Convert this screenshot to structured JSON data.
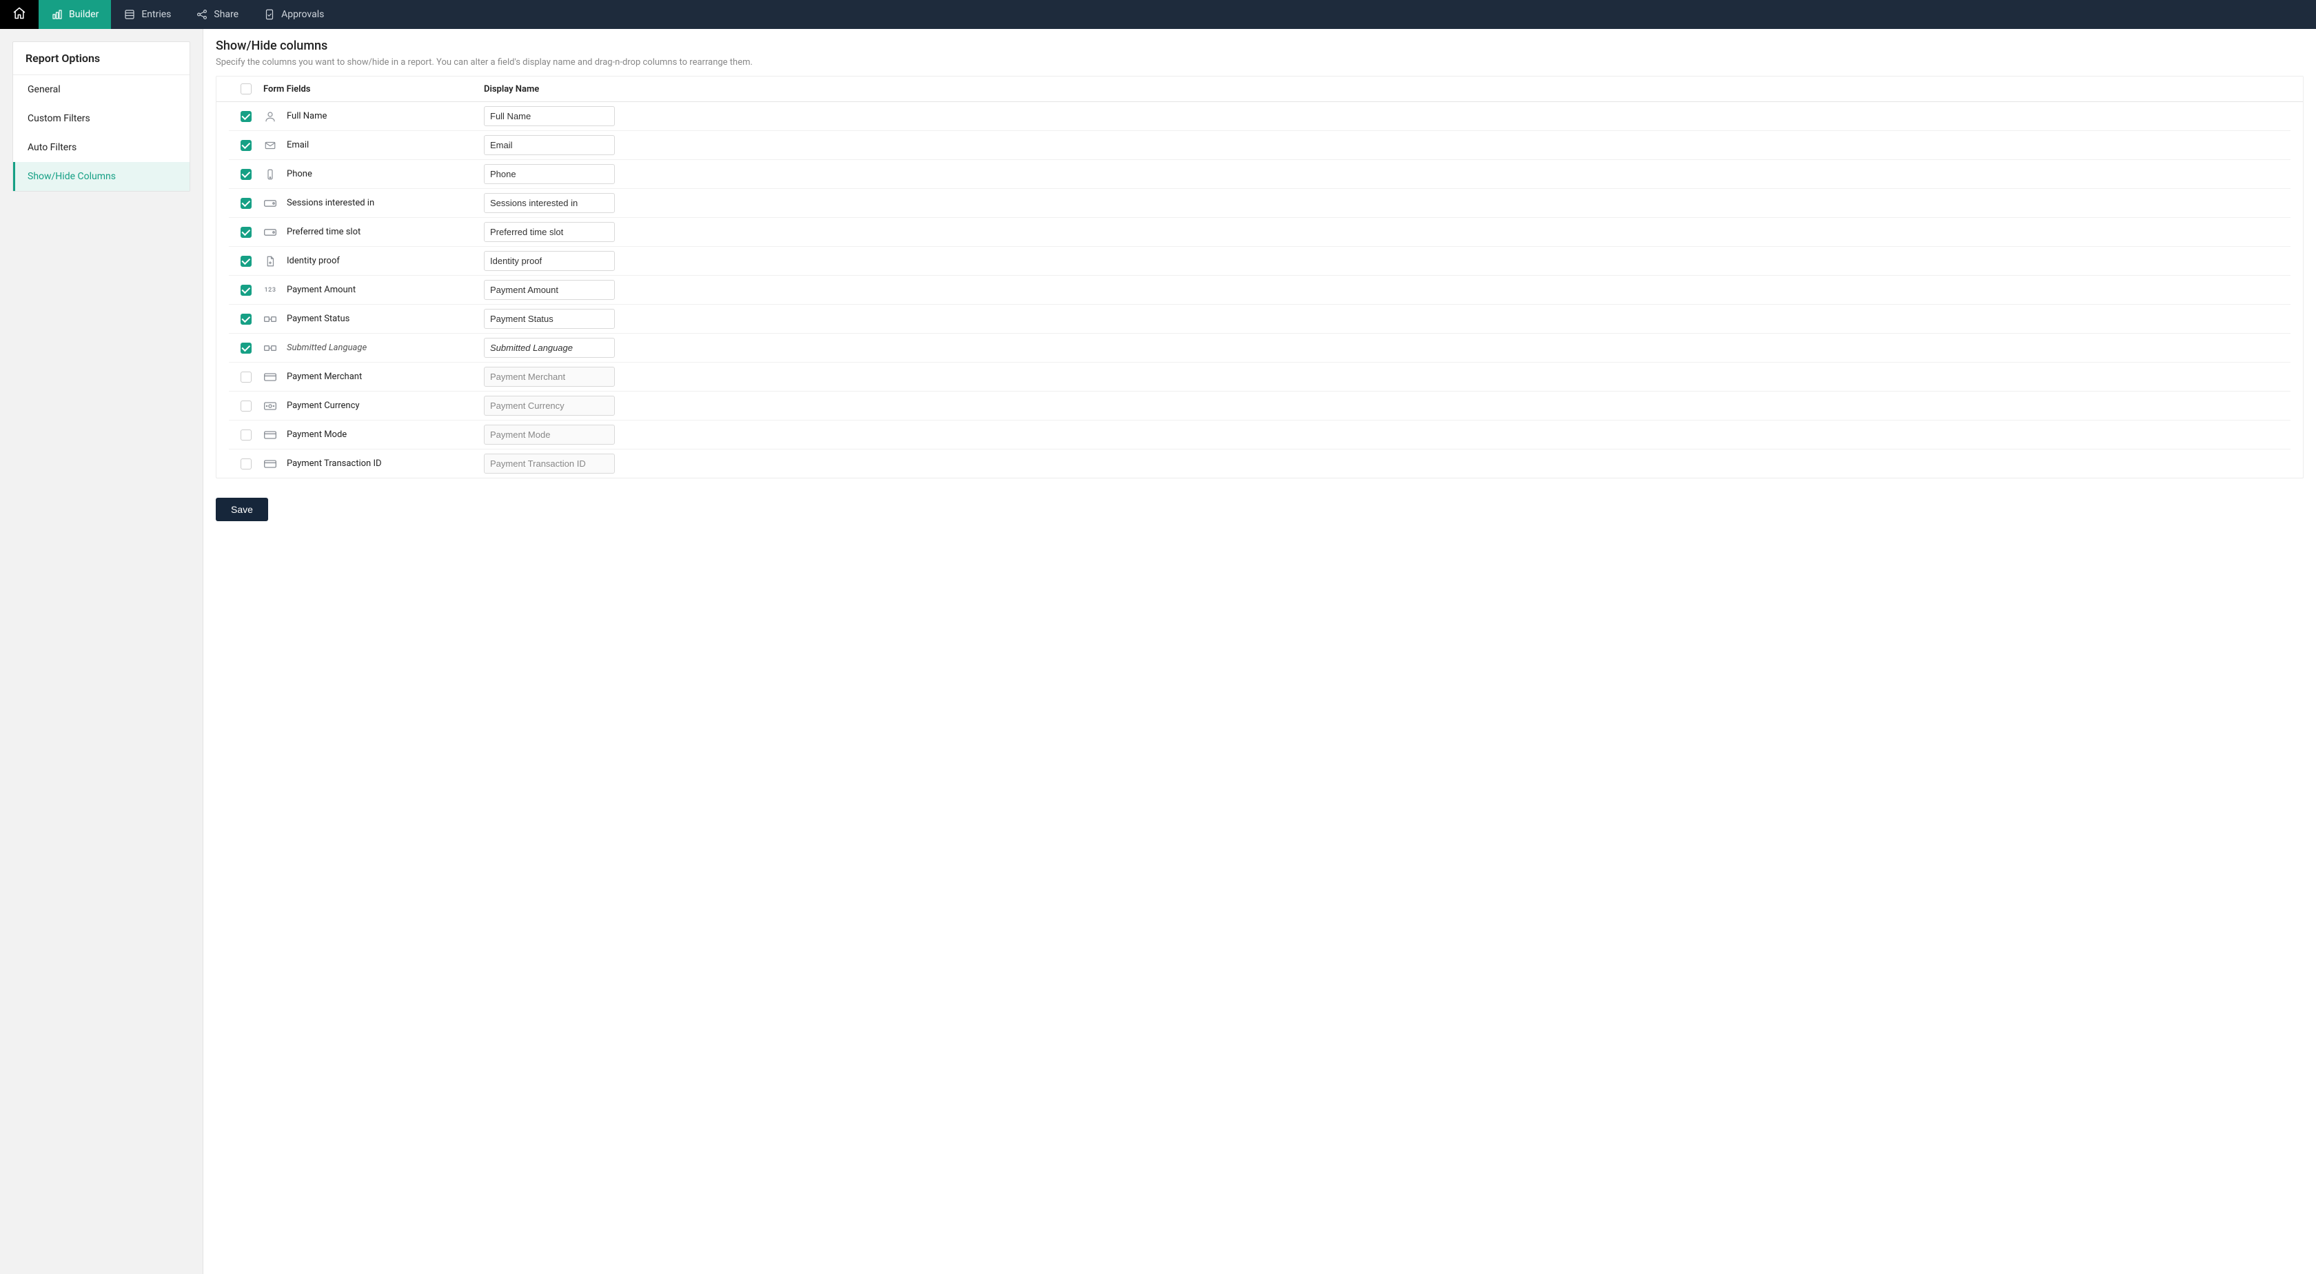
{
  "nav": {
    "home_label": "Home",
    "items": [
      {
        "label": "Builder",
        "active": true
      },
      {
        "label": "Entries",
        "active": false
      },
      {
        "label": "Share",
        "active": false
      },
      {
        "label": "Approvals",
        "active": false
      }
    ]
  },
  "sidebar": {
    "title": "Report Options",
    "items": [
      {
        "label": "General",
        "active": false
      },
      {
        "label": "Custom Filters",
        "active": false
      },
      {
        "label": "Auto Filters",
        "active": false
      },
      {
        "label": "Show/Hide Columns",
        "active": true
      }
    ]
  },
  "main": {
    "title": "Show/Hide columns",
    "subtitle": "Specify the columns you want to show/hide in a report. You can alter a field's display name and drag-n-drop columns to rearrange them.",
    "header_field_label": "Form Fields",
    "header_display_label": "Display Name",
    "select_all_checked": false,
    "save_label": "Save",
    "rows": [
      {
        "checked": true,
        "icon": "person",
        "label": "Full Name",
        "display": "Full Name",
        "italic": false
      },
      {
        "checked": true,
        "icon": "mail",
        "label": "Email",
        "display": "Email",
        "italic": false
      },
      {
        "checked": true,
        "icon": "phone",
        "label": "Phone",
        "display": "Phone",
        "italic": false
      },
      {
        "checked": true,
        "icon": "tag",
        "label": "Sessions interested in",
        "display": "Sessions interested in",
        "italic": false
      },
      {
        "checked": true,
        "icon": "tag",
        "label": "Preferred time slot",
        "display": "Preferred time slot",
        "italic": false
      },
      {
        "checked": true,
        "icon": "doc",
        "label": "Identity proof",
        "display": "Identity proof",
        "italic": false
      },
      {
        "checked": true,
        "icon": "num",
        "label": "Payment Amount",
        "display": "Payment Amount",
        "italic": false
      },
      {
        "checked": true,
        "icon": "tagsplit",
        "label": "Payment Status",
        "display": "Payment Status",
        "italic": false
      },
      {
        "checked": true,
        "icon": "tagsplit",
        "label": "Submitted Language",
        "display": "Submitted Language",
        "italic": true
      },
      {
        "checked": false,
        "icon": "card",
        "label": "Payment Merchant",
        "display": "Payment Merchant",
        "italic": false
      },
      {
        "checked": false,
        "icon": "currency",
        "label": "Payment Currency",
        "display": "Payment Currency",
        "italic": false
      },
      {
        "checked": false,
        "icon": "card",
        "label": "Payment Mode",
        "display": "Payment Mode",
        "italic": false
      },
      {
        "checked": false,
        "icon": "card",
        "label": "Payment Transaction ID",
        "display": "Payment Transaction ID",
        "italic": false
      }
    ]
  }
}
